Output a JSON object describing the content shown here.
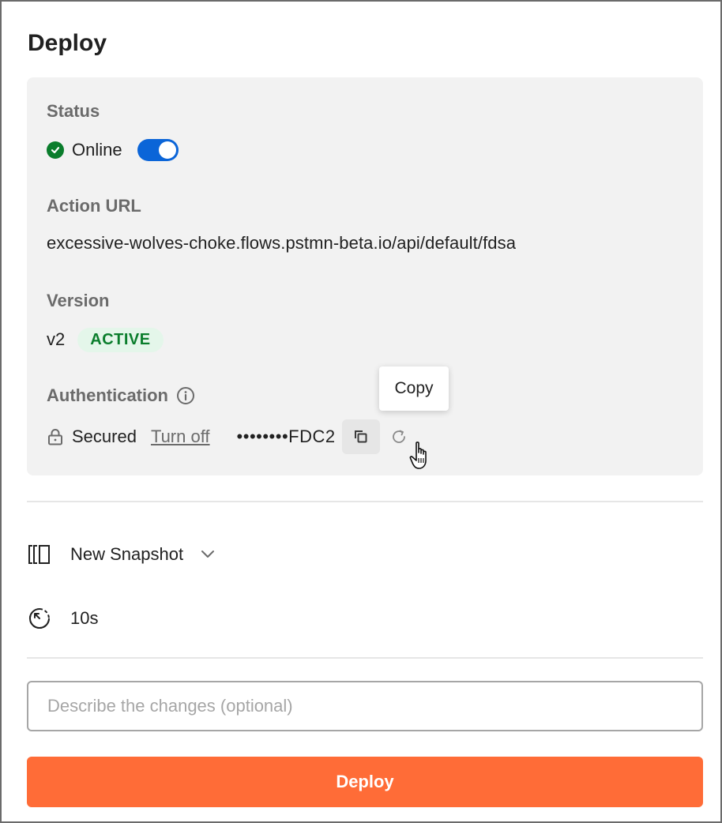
{
  "header": {
    "title": "Deploy"
  },
  "status": {
    "label": "Status",
    "value": "Online",
    "toggle_on": true
  },
  "action_url": {
    "label": "Action URL",
    "value": "excessive-wolves-choke.flows.pstmn-beta.io/api/default/fdsa"
  },
  "version": {
    "label": "Version",
    "value": "v2",
    "badge": "ACTIVE"
  },
  "authentication": {
    "label": "Authentication",
    "state": "Secured",
    "turn_off_label": "Turn off",
    "secret_masked": "••••••••FDC2",
    "copy_tooltip": "Copy"
  },
  "snapshot": {
    "label": "New Snapshot"
  },
  "timeout": {
    "value": "10s"
  },
  "description": {
    "placeholder": "Describe the changes (optional)",
    "value": ""
  },
  "deploy_button": {
    "label": "Deploy"
  },
  "colors": {
    "primary_orange": "#ff6c37",
    "toggle_blue": "#0b65d8",
    "success_green": "#0a7d2c",
    "badge_bg": "#e4f6ea",
    "card_bg": "#f2f2f2",
    "muted_text": "#6b6b6b"
  },
  "icons": {
    "status": "check-circle-icon",
    "info": "info-icon",
    "lock": "lock-icon",
    "copy": "copy-icon",
    "refresh": "refresh-icon",
    "snapshot": "snapshot-icon",
    "chevron": "chevron-down-icon",
    "timer": "timer-icon",
    "cursor": "hand-pointer-cursor-icon"
  }
}
